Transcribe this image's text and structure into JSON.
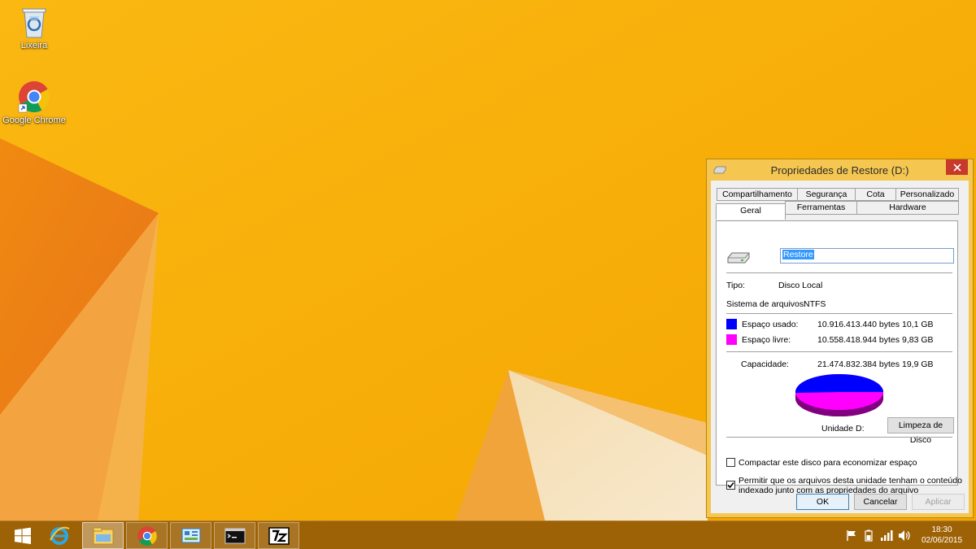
{
  "desktop": {
    "icons": [
      {
        "label": "Lixeira",
        "icon": "recycle-bin-icon"
      },
      {
        "label": "Google Chrome",
        "icon": "chrome-icon"
      }
    ]
  },
  "dialog": {
    "title": "Propriedades de Restore (D:)",
    "tabs_row1": [
      "Compartilhamento",
      "Segurança",
      "Cota",
      "Personalizado"
    ],
    "tabs_row2": [
      "Geral",
      "Ferramentas",
      "Hardware"
    ],
    "selected_tab": "Geral",
    "drive_name": "Restore",
    "type_label": "Tipo:",
    "type_value": "Disco Local",
    "fs_label": "Sistema de arquivos:",
    "fs_value": "NTFS",
    "used_label": "Espaço usado:",
    "used_bytes": "10.916.413.440 bytes",
    "used_size": "10,1 GB",
    "free_label": "Espaço livre:",
    "free_bytes": "10.558.418.944 bytes",
    "free_size": "9,83 GB",
    "capacity_label": "Capacidade:",
    "capacity_bytes": "21.474.832.384 bytes",
    "capacity_size": "19,9 GB",
    "drive_label": "Unidade D:",
    "cleanup_button": "Limpeza de Disco",
    "compress_label": "Compactar este disco para economizar espaço",
    "compress_checked": false,
    "index_label_line1": "Permitir que os arquivos desta unidade tenham o conteúdo",
    "index_label_line2": "indexado junto com as propriedades do arquivo",
    "index_checked": true,
    "ok_button": "OK",
    "cancel_button": "Cancelar",
    "apply_button": "Aplicar",
    "colors": {
      "used": "#0000ff",
      "free": "#ff00ff"
    },
    "used_fraction": 0.508
  },
  "taskbar": {
    "items": [
      "start-icon",
      "internet-explorer-icon",
      "file-explorer-icon",
      "chrome-icon",
      "control-panel-icon",
      "command-prompt-icon",
      "7zip-icon"
    ],
    "time": "18:30",
    "date": "02/06/2015"
  }
}
